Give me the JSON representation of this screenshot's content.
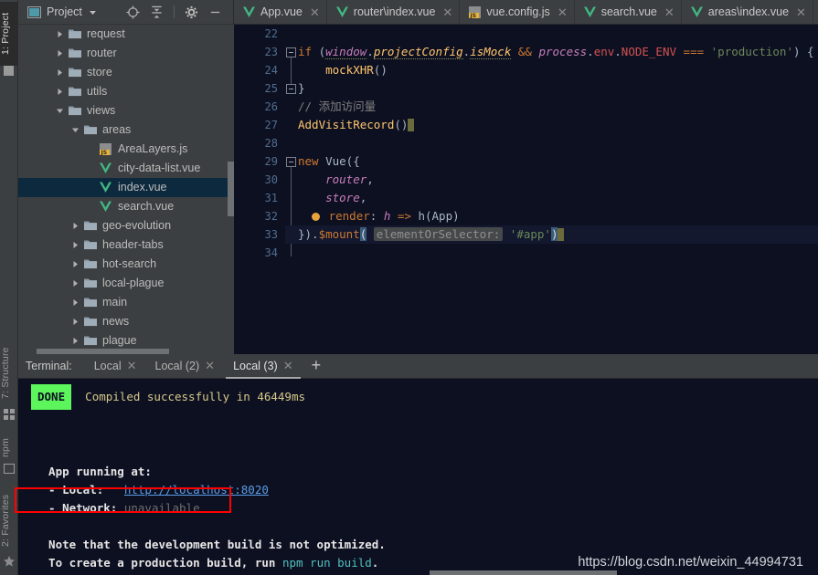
{
  "left_strip": {
    "tabs": [
      {
        "label": "1: Project",
        "active": true
      },
      {
        "label": "7: Structure",
        "active": false
      },
      {
        "label": "npm",
        "active": false
      },
      {
        "label": "2: Favorites",
        "active": false
      }
    ]
  },
  "project_panel": {
    "title": "Project",
    "icons": [
      {
        "name": "locate-icon",
        "glyph": "locate"
      },
      {
        "name": "collapse-all-icon",
        "glyph": "collapse"
      },
      {
        "name": "settings-gear-icon",
        "glyph": "gear"
      },
      {
        "name": "hide-panel-icon",
        "glyph": "minus"
      }
    ],
    "tree": [
      {
        "label": "request",
        "type": "folder",
        "indent": 2,
        "expanded": false,
        "selected": false
      },
      {
        "label": "router",
        "type": "folder",
        "indent": 2,
        "expanded": false,
        "selected": false
      },
      {
        "label": "store",
        "type": "folder",
        "indent": 2,
        "expanded": false,
        "selected": false
      },
      {
        "label": "utils",
        "type": "folder",
        "indent": 2,
        "expanded": false,
        "selected": false
      },
      {
        "label": "views",
        "type": "folder",
        "indent": 2,
        "expanded": true,
        "selected": false
      },
      {
        "label": "areas",
        "type": "folder",
        "indent": 3,
        "expanded": true,
        "selected": false
      },
      {
        "label": "AreaLayers.js",
        "type": "js",
        "indent": 4,
        "expanded": null,
        "selected": false
      },
      {
        "label": "city-data-list.vue",
        "type": "vue",
        "indent": 4,
        "expanded": null,
        "selected": false
      },
      {
        "label": "index.vue",
        "type": "vue",
        "indent": 4,
        "expanded": null,
        "selected": true
      },
      {
        "label": "search.vue",
        "type": "vue",
        "indent": 4,
        "expanded": null,
        "selected": false
      },
      {
        "label": "geo-evolution",
        "type": "folder",
        "indent": 3,
        "expanded": false,
        "selected": false
      },
      {
        "label": "header-tabs",
        "type": "folder",
        "indent": 3,
        "expanded": false,
        "selected": false
      },
      {
        "label": "hot-search",
        "type": "folder",
        "indent": 3,
        "expanded": false,
        "selected": false
      },
      {
        "label": "local-plague",
        "type": "folder",
        "indent": 3,
        "expanded": false,
        "selected": false
      },
      {
        "label": "main",
        "type": "folder",
        "indent": 3,
        "expanded": false,
        "selected": false
      },
      {
        "label": "news",
        "type": "folder",
        "indent": 3,
        "expanded": false,
        "selected": false
      },
      {
        "label": "plague",
        "type": "folder",
        "indent": 3,
        "expanded": false,
        "selected": false
      }
    ]
  },
  "editor_tabs": [
    {
      "label": "App.vue",
      "icon": "vue",
      "active": false
    },
    {
      "label": "router\\index.vue",
      "icon": "vue",
      "active": false
    },
    {
      "label": "vue.config.js",
      "icon": "js",
      "active": false
    },
    {
      "label": "search.vue",
      "icon": "vue",
      "active": false
    },
    {
      "label": "areas\\index.vue",
      "icon": "vue",
      "active": false
    }
  ],
  "editor": {
    "first_line": 22,
    "line_numbers": [
      22,
      23,
      24,
      25,
      26,
      27,
      28,
      29,
      30,
      31,
      32,
      33,
      34
    ],
    "lines": [
      {
        "n": 22,
        "text": ""
      },
      {
        "n": 23,
        "text": "if (window.projectConfig.isMock && process.env.NODE_ENV === 'production') {"
      },
      {
        "n": 24,
        "text": "    mockXHR()"
      },
      {
        "n": 25,
        "text": "}"
      },
      {
        "n": 26,
        "text": "// 添加访问量"
      },
      {
        "n": 27,
        "text": "AddVisitRecord()"
      },
      {
        "n": 28,
        "text": ""
      },
      {
        "n": 29,
        "text": "new Vue({"
      },
      {
        "n": 30,
        "text": "    router,"
      },
      {
        "n": 31,
        "text": "    store,"
      },
      {
        "n": 32,
        "text": "    render: h => h(App)"
      },
      {
        "n": 33,
        "text": "}).$mount( elementOrSelector: '#app')"
      },
      {
        "n": 34,
        "text": ""
      }
    ],
    "param_hint": "elementOrSelector:",
    "comment_text": "// 添加访问量"
  },
  "terminal": {
    "title": "Terminal:",
    "tabs": [
      {
        "label": "Local",
        "active": false
      },
      {
        "label": "Local (2)",
        "active": false
      },
      {
        "label": "Local (3)",
        "active": true
      }
    ],
    "add_tab_label": "+",
    "output": {
      "done_badge": "DONE",
      "compiled_text": "Compiled successfully in 46449ms",
      "app_running_at": "  App running at:",
      "local_label": "  - Local:   ",
      "local_url": "http://localhost:8020",
      "network_label": "  - Network: ",
      "network_value": "unavailable",
      "note_line": "  Note that the development build is not optimized.",
      "build_line_prefix": "  To create a production build, run ",
      "build_cmd": "npm run build",
      "build_line_suffix": "."
    }
  },
  "watermark": "https://blog.csdn.net/weixin_44994731",
  "colors": {
    "panel_bg": "#3c3f41",
    "editor_bg": "#0d1021",
    "selection_blue": "#0d293e",
    "done_green": "#5cf55c",
    "highlight_red": "#ff0000",
    "link_blue": "#5a9ee8"
  }
}
